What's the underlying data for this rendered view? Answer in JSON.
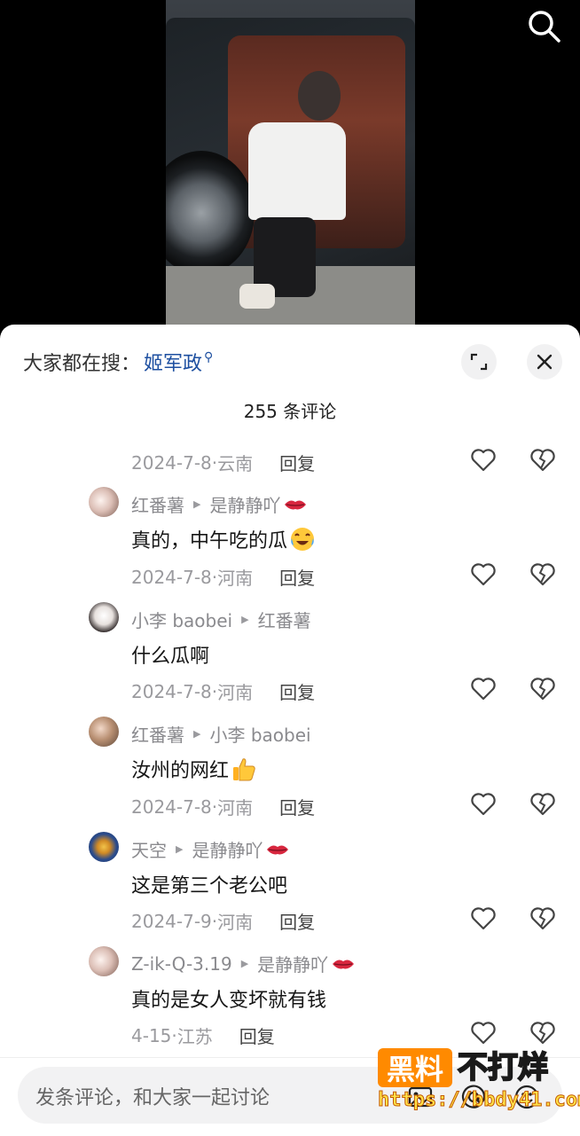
{
  "hot_search": {
    "label": "大家都在搜：",
    "term": "姬军政"
  },
  "comment_count": "255 条评论",
  "comments": [
    {
      "author": "",
      "reply_to": "",
      "text": "",
      "date": "2024-7-8",
      "location": "云南",
      "reply_label": "回复"
    },
    {
      "author": "红番薯",
      "reply_to": "是静静吖",
      "text": "真的，中午吃的瓜",
      "date": "2024-7-8",
      "location": "河南",
      "reply_label": "回复"
    },
    {
      "author": "小李 baobei",
      "reply_to": "红番薯",
      "text": "什么瓜啊",
      "date": "2024-7-8",
      "location": "河南",
      "reply_label": "回复"
    },
    {
      "author": "红番薯",
      "reply_to": "小李 baobei",
      "text": "汝州的网红",
      "date": "2024-7-8",
      "location": "河南",
      "reply_label": "回复"
    },
    {
      "author": "天空",
      "reply_to": "是静静吖",
      "text": "这是第三个老公吧",
      "date": "2024-7-9",
      "location": "河南",
      "reply_label": "回复"
    },
    {
      "author": "Z-ik-Q-3.19",
      "reply_to": "是静静吖",
      "text": "真的是女人变坏就有钱",
      "date": "4-15",
      "location": "江苏",
      "reply_label": "回复"
    }
  ],
  "input": {
    "placeholder": "发条评论，和大家一起讨论"
  },
  "watermark": {
    "brand": "黑料",
    "title": "不打烊",
    "url": "https://bbdy41.com"
  },
  "colors": {
    "accent_link": "#1d4fa0",
    "watermark_orange": "#ff8a00"
  }
}
